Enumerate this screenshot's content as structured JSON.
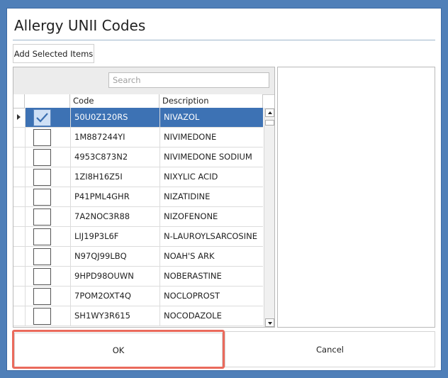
{
  "window": {
    "title": "Allergy UNII Codes"
  },
  "toolbar": {
    "add_selected_label": "Add Selected Items"
  },
  "search": {
    "placeholder": "Search",
    "value": ""
  },
  "grid": {
    "columns": [
      "Code",
      "Description"
    ],
    "selected_index": 0,
    "rows": [
      {
        "code": "50U0Z120RS",
        "description": "NIVAZOL",
        "checked": true
      },
      {
        "code": "1M887244YI",
        "description": "NIVIMEDONE",
        "checked": false
      },
      {
        "code": "4953C873N2",
        "description": "NIVIMEDONE SODIUM",
        "checked": false
      },
      {
        "code": "1ZI8H16Z5I",
        "description": "NIXYLIC ACID",
        "checked": false
      },
      {
        "code": "P41PML4GHR",
        "description": "NIZATIDINE",
        "checked": false
      },
      {
        "code": "7A2NOC3R88",
        "description": "NIZOFENONE",
        "checked": false
      },
      {
        "code": "LIJ19P3L6F",
        "description": "N-LAUROYLSARCOSINE",
        "checked": false
      },
      {
        "code": "N97QJ99LBQ",
        "description": "NOAH'S ARK",
        "checked": false
      },
      {
        "code": "9HPD98OUWN",
        "description": "NOBERASTINE",
        "checked": false
      },
      {
        "code": "7POM2OXT4Q",
        "description": "NOCLOPROST",
        "checked": false
      },
      {
        "code": "SH1WY3R615",
        "description": "NOCODAZOLE",
        "checked": false
      }
    ]
  },
  "footer": {
    "ok_label": "OK",
    "cancel_label": "Cancel"
  },
  "colors": {
    "window_border": "#4f7fb8",
    "selection": "#3d72b4",
    "highlight": "#ea6a5c"
  }
}
